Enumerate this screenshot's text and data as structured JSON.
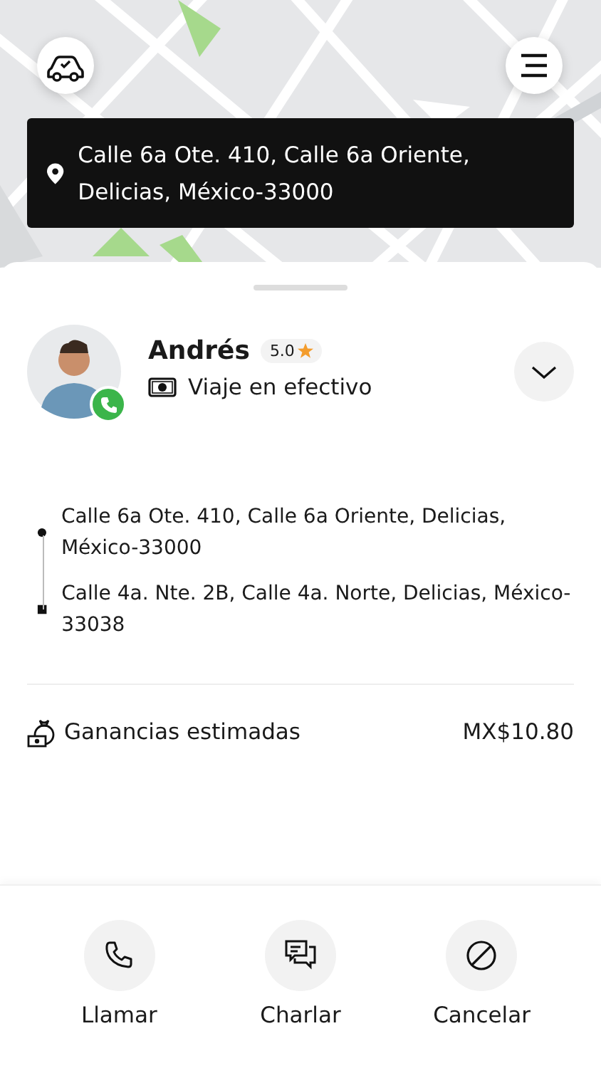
{
  "map": {
    "kind": "picture",
    "pickup_banner": {
      "address": "Calle 6a Ote. 410, Calle 6a Oriente, Delicias, México-33000"
    }
  },
  "driver": {
    "name": "Andrés",
    "rating": "5.0",
    "payment": "Viaje en efectivo",
    "expanded": false
  },
  "route": [
    {
      "kind": "pickup",
      "address": "Calle 6a Ote. 410, Calle 6a Oriente, Delicias, México-33000"
    },
    {
      "kind": "dropoff",
      "address": "Calle 4a. Nte. 2B, Calle 4a. Norte, Delicias, México-33038"
    }
  ],
  "earnings": {
    "label": "Ganancias estimadas",
    "amount": "MX$10.80"
  },
  "actions": [
    {
      "kind": "call",
      "label": "Llamar"
    },
    {
      "kind": "chat",
      "label": "Charlar"
    },
    {
      "kind": "cancel",
      "label": "Cancelar"
    }
  ]
}
